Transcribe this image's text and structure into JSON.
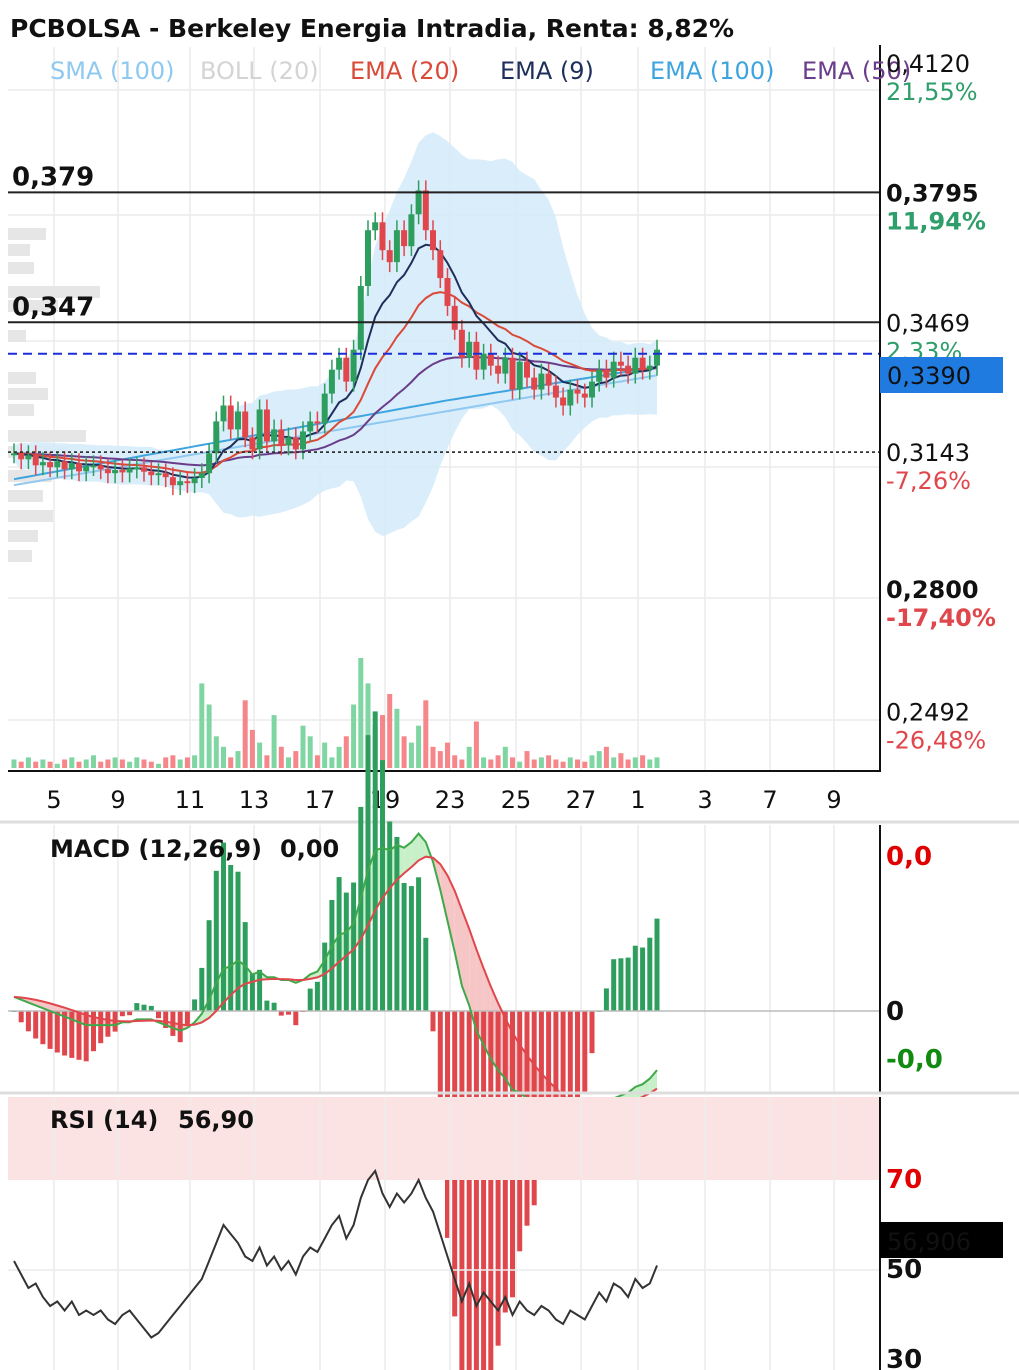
{
  "title": "PCBOLSA - Berkeley Energia Intradia, Renta: 8,82%",
  "legend": [
    {
      "label": "SMA (100)",
      "color": "#8fc8f0"
    },
    {
      "label": "BOLL (20)",
      "color": "#d4d4d4"
    },
    {
      "label": "EMA (20)",
      "color": "#d94a38"
    },
    {
      "label": "EMA (9)",
      "color": "#1f2f5c"
    },
    {
      "label": "EMA (100)",
      "color": "#3ea4e0"
    },
    {
      "label": "EMA (50)",
      "color": "#6a3d8a"
    }
  ],
  "colors": {
    "up": "#2e9e5e",
    "down": "#e0474c",
    "vol_up": "#7fd6a3",
    "vol_down": "#f5868a",
    "boll_fill": "#d6ebfa",
    "current_line": "#1a2fd8",
    "current_badge": "#1f7be0",
    "rsi_badge": "#000000",
    "macd_up_fill": "#c7f0c8",
    "macd_down_fill": "#f6c6c6",
    "macd_line": "#3fa84a",
    "signal_line": "#e0474c",
    "rsi_zone": "#fbe3e3"
  },
  "price_axis": [
    {
      "value": "0,4120",
      "pct": "21,55%",
      "bold": false,
      "pct_color": "#2e9e6a"
    },
    {
      "value": "0,3795",
      "pct": "11,94%",
      "bold": true,
      "pct_color": "#2e9e6a"
    },
    {
      "value": "0,3469",
      "pct": "2,33%",
      "bold": false,
      "pct_color": "#2e9e6a"
    },
    {
      "value": "0,3143",
      "pct": "-7,26%",
      "bold": false,
      "pct_color": "#e0474c"
    },
    {
      "value": "0,2800",
      "pct": "-17,40%",
      "bold": true,
      "pct_color": "#e0474c"
    },
    {
      "value": "0,2492",
      "pct": "-26,48%",
      "bold": false,
      "pct_color": "#e0474c"
    }
  ],
  "levels": [
    {
      "label": "0,379",
      "value": 0.3795
    },
    {
      "label": "0,347",
      "value": 0.3469
    }
  ],
  "reference_dotted": 0.3143,
  "current_price": {
    "value": 0.339,
    "label": "0,3390"
  },
  "x_axis": [
    "5",
    "9",
    "11",
    "13",
    "17",
    "19",
    "23",
    "25",
    "27",
    "1",
    "3",
    "7",
    "9"
  ],
  "macd": {
    "title": "MACD (12,26,9)",
    "value": "0,00",
    "axis": [
      {
        "label": "0,0",
        "color": "#e00000"
      },
      {
        "label": "0",
        "color": "#111111"
      },
      {
        "label": "-0,0",
        "color": "#118a11"
      }
    ]
  },
  "rsi": {
    "title": "RSI (14)",
    "value": "56,90",
    "badge": "56,906",
    "axis": [
      "70",
      "50",
      "30"
    ]
  },
  "chart_data": {
    "type": "line",
    "price_range": [
      0.2345,
      0.416
    ],
    "close": [
      0.314,
      0.3125,
      0.3135,
      0.311,
      0.3118,
      0.3105,
      0.312,
      0.31,
      0.3115,
      0.3095,
      0.3108,
      0.311,
      0.31,
      0.309,
      0.3098,
      0.3092,
      0.3102,
      0.3105,
      0.3094,
      0.3085,
      0.309,
      0.308,
      0.306,
      0.307,
      0.3065,
      0.3078,
      0.309,
      0.314,
      0.322,
      0.326,
      0.32,
      0.3245,
      0.318,
      0.315,
      0.325,
      0.317,
      0.32,
      0.316,
      0.318,
      0.315,
      0.3195,
      0.322,
      0.3215,
      0.329,
      0.335,
      0.338,
      0.332,
      0.34,
      0.356,
      0.37,
      0.372,
      0.365,
      0.362,
      0.37,
      0.366,
      0.374,
      0.38,
      0.37,
      0.365,
      0.358,
      0.351,
      0.345,
      0.338,
      0.342,
      0.335,
      0.339,
      0.336,
      0.334,
      0.338,
      0.33,
      0.337,
      0.333,
      0.33,
      0.334,
      0.331,
      0.328,
      0.326,
      0.33,
      0.329,
      0.328,
      0.332,
      0.335,
      0.333,
      0.337,
      0.336,
      0.334,
      0.338,
      0.335,
      0.336,
      0.34
    ],
    "volume": [
      0.04,
      0.03,
      0.05,
      0.03,
      0.04,
      0.03,
      0.02,
      0.04,
      0.05,
      0.03,
      0.04,
      0.06,
      0.03,
      0.04,
      0.05,
      0.04,
      0.03,
      0.05,
      0.04,
      0.03,
      0.02,
      0.05,
      0.06,
      0.04,
      0.05,
      0.06,
      0.4,
      0.3,
      0.15,
      0.1,
      0.05,
      0.08,
      0.32,
      0.18,
      0.12,
      0.06,
      0.25,
      0.1,
      0.05,
      0.08,
      0.2,
      0.15,
      0.06,
      0.12,
      0.05,
      0.1,
      0.15,
      0.3,
      0.52,
      0.4,
      0.2,
      0.25,
      0.35,
      0.28,
      0.15,
      0.12,
      0.2,
      0.32,
      0.1,
      0.08,
      0.12,
      0.06,
      0.04,
      0.1,
      0.22,
      0.05,
      0.04,
      0.06,
      0.1,
      0.05,
      0.03,
      0.08,
      0.04,
      0.05,
      0.06,
      0.04,
      0.03,
      0.05,
      0.04,
      0.03,
      0.06,
      0.08,
      0.1,
      0.05,
      0.07,
      0.04,
      0.05,
      0.06,
      0.04,
      0.05
    ],
    "rsi": [
      52,
      49,
      46,
      47,
      44,
      42,
      43,
      41,
      43,
      40,
      41,
      40,
      41,
      39,
      38,
      40,
      41,
      39,
      37,
      35,
      36,
      38,
      40,
      42,
      44,
      46,
      48,
      52,
      56,
      60,
      58,
      56,
      53,
      52,
      55,
      51,
      53,
      50,
      52,
      49,
      53,
      55,
      54,
      57,
      60,
      62,
      57,
      60,
      66,
      70,
      72,
      67,
      64,
      67,
      65,
      67,
      70,
      66,
      63,
      58,
      53,
      48,
      43,
      47,
      42,
      45,
      43,
      41,
      44,
      40,
      43,
      41,
      40,
      42,
      41,
      39,
      38,
      41,
      40,
      39,
      42,
      45,
      43,
      47,
      46,
      44,
      48,
      46,
      47,
      51
    ],
    "macd": [
      0.0005,
      0.0004,
      0.0003,
      0.0002,
      0.0001,
      0.0,
      -0.0001,
      -0.0002,
      -0.0003,
      -0.0004,
      -0.0005,
      -0.0005,
      -0.0005,
      -0.0005,
      -0.0005,
      -0.0004,
      -0.0004,
      -0.0003,
      -0.0003,
      -0.0003,
      -0.0004,
      -0.0005,
      -0.0006,
      -0.0007,
      -0.0006,
      -0.0004,
      -0.0001,
      0.0004,
      0.001,
      0.0015,
      0.0016,
      0.0018,
      0.0016,
      0.0013,
      0.0014,
      0.0012,
      0.0012,
      0.0011,
      0.0011,
      0.001,
      0.0011,
      0.0013,
      0.0014,
      0.0018,
      0.0023,
      0.0027,
      0.0028,
      0.0031,
      0.004,
      0.005,
      0.0057,
      0.0058,
      0.0057,
      0.0059,
      0.0058,
      0.006,
      0.0063,
      0.006,
      0.0053,
      0.0043,
      0.0032,
      0.0021,
      0.0009,
      0.0002,
      -0.0007,
      -0.0012,
      -0.0017,
      -0.0021,
      -0.0024,
      -0.0028,
      -0.0029,
      -0.0031,
      -0.0033,
      -0.0034,
      -0.0036,
      -0.0038,
      -0.004,
      -0.004,
      -0.0041,
      -0.0041,
      -0.0039,
      -0.0036,
      -0.0034,
      -0.0031,
      -0.003,
      -0.0029,
      -0.0027,
      -0.0026,
      -0.0024,
      -0.0021
    ],
    "macd_ylim": [
      -0.0045,
      0.0065
    ],
    "rsi_ylim": [
      30,
      85
    ]
  }
}
